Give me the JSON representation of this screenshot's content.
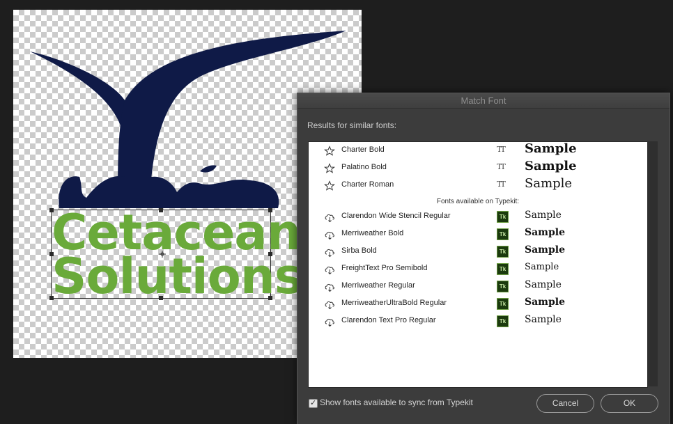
{
  "canvas": {
    "logo_line_1": "Cetacean",
    "logo_line_2": "Solutions",
    "colors": {
      "whale": "#0f1a47",
      "logo_text": "#6aaa3a"
    }
  },
  "dialog": {
    "title": "Match Font",
    "results_label": "Results for similar fonts:",
    "local_fonts": [
      {
        "name": "Charter Bold",
        "icon": "star-icon",
        "type_icon": "truetype-icon",
        "sample": "Sample"
      },
      {
        "name": "Palatino Bold",
        "icon": "star-icon",
        "type_icon": "truetype-icon",
        "sample": "Sample"
      },
      {
        "name": "Charter Roman",
        "icon": "star-icon",
        "type_icon": "truetype-icon",
        "sample": "Sample"
      }
    ],
    "typekit_header": "Fonts available on Typekit:",
    "typekit_fonts": [
      {
        "name": "Clarendon Wide Stencil Regular",
        "icon": "cloud-download-icon",
        "type_icon": "typekit-icon",
        "type_label": "Tk",
        "sample": "Sample"
      },
      {
        "name": "Merriweather Bold",
        "icon": "cloud-download-icon",
        "type_icon": "typekit-icon",
        "type_label": "Tk",
        "sample": "Sample"
      },
      {
        "name": "Sirba Bold",
        "icon": "cloud-download-icon",
        "type_icon": "typekit-icon",
        "type_label": "Tk",
        "sample": "Sample"
      },
      {
        "name": "FreightText Pro Semibold",
        "icon": "cloud-download-icon",
        "type_icon": "typekit-icon",
        "type_label": "Tk",
        "sample": "Sample"
      },
      {
        "name": "Merriweather Regular",
        "icon": "cloud-download-icon",
        "type_icon": "typekit-icon",
        "type_label": "Tk",
        "sample": "Sample"
      },
      {
        "name": "MerriweatherUltraBold Regular",
        "icon": "cloud-download-icon",
        "type_icon": "typekit-icon",
        "type_label": "Tk",
        "sample": "Sample"
      },
      {
        "name": "Clarendon Text Pro Regular",
        "icon": "cloud-download-icon",
        "type_icon": "typekit-icon",
        "type_label": "Tk",
        "sample": "Sample"
      }
    ],
    "show_typekit_checked": true,
    "show_typekit_label": "Show fonts available to sync from Typekit",
    "cancel_label": "Cancel",
    "ok_label": "OK"
  }
}
